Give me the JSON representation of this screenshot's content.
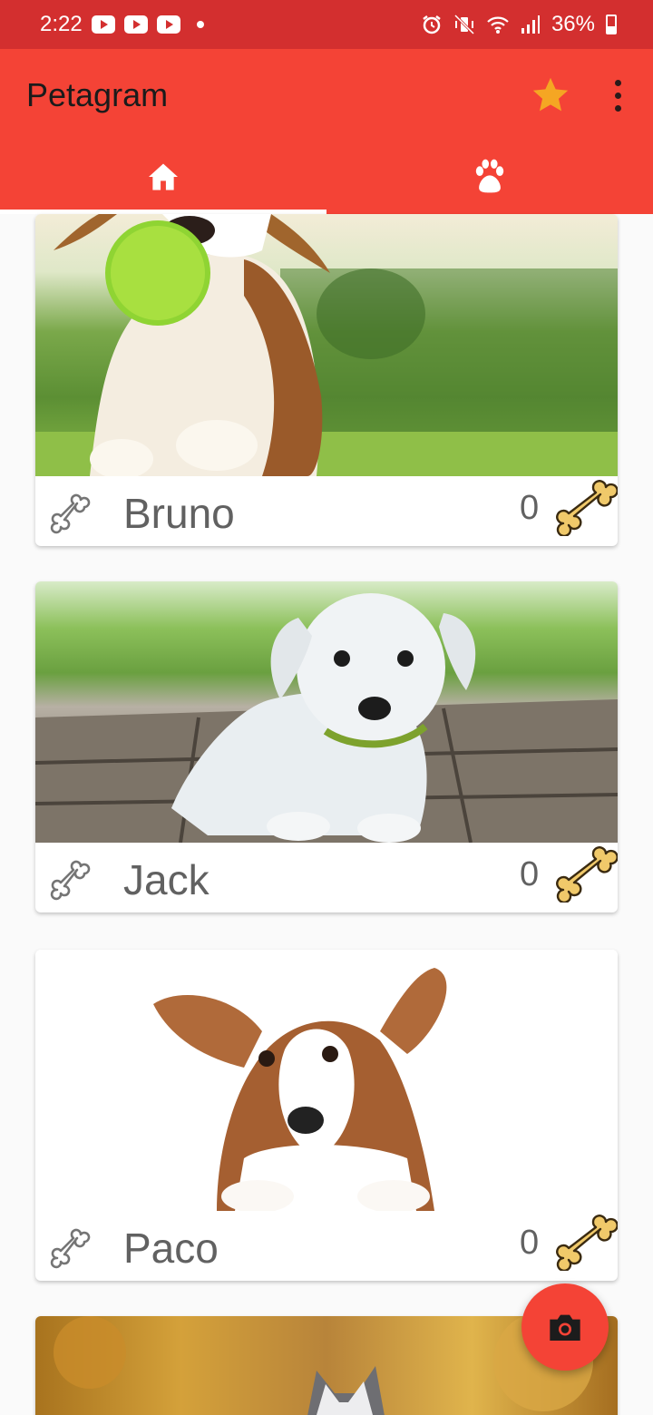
{
  "status_bar": {
    "time": "2:22",
    "battery": "36%",
    "notification_icons": [
      "youtube-icon",
      "youtube-icon",
      "youtube-icon"
    ]
  },
  "app_bar": {
    "title": "Petagram",
    "actions": [
      "star-icon",
      "more-vert-icon"
    ],
    "tabs": [
      {
        "icon": "home-icon",
        "active": true
      },
      {
        "icon": "paw-icon",
        "active": false
      }
    ]
  },
  "pets": [
    {
      "name": "Bruno",
      "likes": "0"
    },
    {
      "name": "Jack",
      "likes": "0"
    },
    {
      "name": "Paco",
      "likes": "0"
    }
  ],
  "fab": {
    "icon": "camera-icon"
  },
  "colors": {
    "status_bar": "#d32f2f",
    "primary": "#f44336",
    "accent_star": "#f5a623",
    "bone_gold": "#f0c96a"
  }
}
